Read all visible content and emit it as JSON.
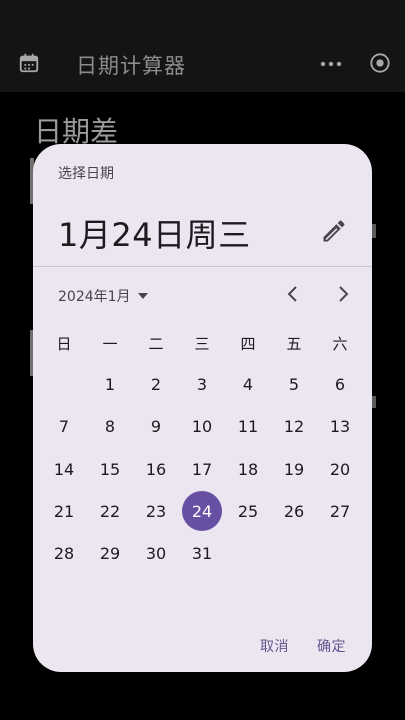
{
  "app": {
    "title": "日期计算器",
    "heading": "日期差",
    "icons": [
      "calendar-icon",
      "more-horiz-icon",
      "radio-target-icon"
    ]
  },
  "dialog": {
    "label": "选择日期",
    "headline": "1月24日周三",
    "edit_icon": "pencil-icon",
    "month_label": "2024年1月",
    "weekdays": [
      "日",
      "一",
      "二",
      "三",
      "四",
      "五",
      "六"
    ],
    "weeks": [
      [
        "",
        "1",
        "2",
        "3",
        "4",
        "5",
        "6"
      ],
      [
        "7",
        "8",
        "9",
        "10",
        "11",
        "12",
        "13"
      ],
      [
        "14",
        "15",
        "16",
        "17",
        "18",
        "19",
        "20"
      ],
      [
        "21",
        "22",
        "23",
        "24",
        "25",
        "26",
        "27"
      ],
      [
        "28",
        "29",
        "30",
        "31",
        "",
        "",
        ""
      ]
    ],
    "selected_day": "24",
    "cancel_label": "取消",
    "confirm_label": "确定",
    "colors": {
      "accent": "#6750a4",
      "surface": "#ece6f0",
      "action": "#65558f"
    }
  }
}
